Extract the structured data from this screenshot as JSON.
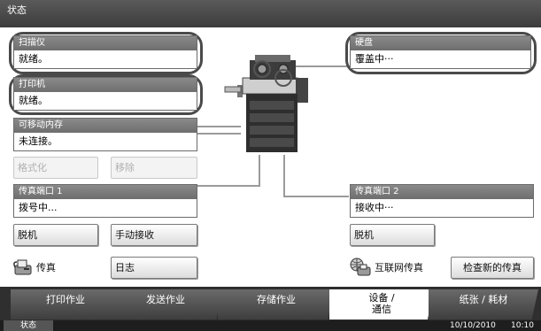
{
  "window": {
    "title": "状态"
  },
  "panels": {
    "scanner": {
      "title": "扫描仪",
      "status": "就绪。"
    },
    "printer": {
      "title": "打印机",
      "status": "就绪。"
    },
    "hdd": {
      "title": "硬盘",
      "status": "覆盖中···"
    },
    "removable": {
      "title": "可移动内存",
      "status": "未连接。"
    },
    "fax_port1": {
      "title": "传真端口 1",
      "status": "拨号中..."
    },
    "fax_port2": {
      "title": "传真端口 2",
      "status": "接收中···"
    }
  },
  "buttons": {
    "format": "格式化",
    "remove": "移除",
    "offline_left": "脱机",
    "manual_receive": "手动接收",
    "offline_right": "脱机",
    "fax": "传真",
    "log": "日志",
    "internet_fax": "互联网传真",
    "check_new_fax": "检查新的传真"
  },
  "tabs": [
    {
      "label": "打印作业",
      "active": false
    },
    {
      "label": "发送作业",
      "active": false
    },
    {
      "label": "存储作业",
      "active": false
    },
    {
      "label_line1": "设备 /",
      "label_line2": "通信",
      "active": true
    },
    {
      "label": "纸张 / 耗材",
      "active": false
    }
  ],
  "footer": {
    "status": "状态",
    "date": "10/10/2010",
    "time": "10:10"
  },
  "icons": {
    "fax": "fax-icon",
    "internet_fax": "internet-fax-icon",
    "device": "mfp-device-icon"
  }
}
